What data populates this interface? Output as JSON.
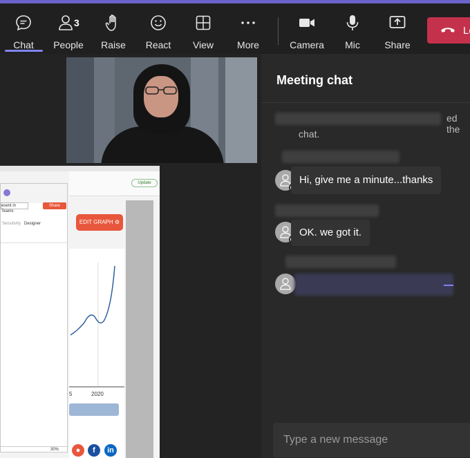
{
  "toolbar": {
    "items": [
      {
        "label": "Chat",
        "icon": "chat-icon",
        "active": true
      },
      {
        "label": "People",
        "icon": "people-icon",
        "count": "3"
      },
      {
        "label": "Raise",
        "icon": "raise-hand-icon"
      },
      {
        "label": "React",
        "icon": "smiley-icon"
      },
      {
        "label": "View",
        "icon": "grid-icon"
      },
      {
        "label": "More",
        "icon": "more-dots-icon"
      },
      {
        "label": "Camera",
        "icon": "camera-icon"
      },
      {
        "label": "Mic",
        "icon": "mic-icon"
      },
      {
        "label": "Share",
        "icon": "share-screen-icon"
      }
    ],
    "leave": {
      "label": "Le",
      "icon": "hangup-phone-icon",
      "color": "#c4314b"
    },
    "accent": "#7f85f5"
  },
  "shared_screen": {
    "edit_graph_label": "EDIT GRAPH",
    "share_label": "Share",
    "present_label": "esent in Teams",
    "sensitivity_label": "Sensitivity",
    "designer_label": "Designer",
    "update_label": "Update",
    "year_left": "5",
    "year_right": "2020",
    "zoom": "30%"
  },
  "chat": {
    "title": "Meeting chat",
    "system_message_tail": "ed the",
    "system_message_line2": "chat.",
    "messages": [
      {
        "text": "Hi, give me a minute...thanks"
      },
      {
        "text": "OK.  we got it."
      },
      {
        "text": ""
      }
    ],
    "input_placeholder": "Type a new message"
  }
}
